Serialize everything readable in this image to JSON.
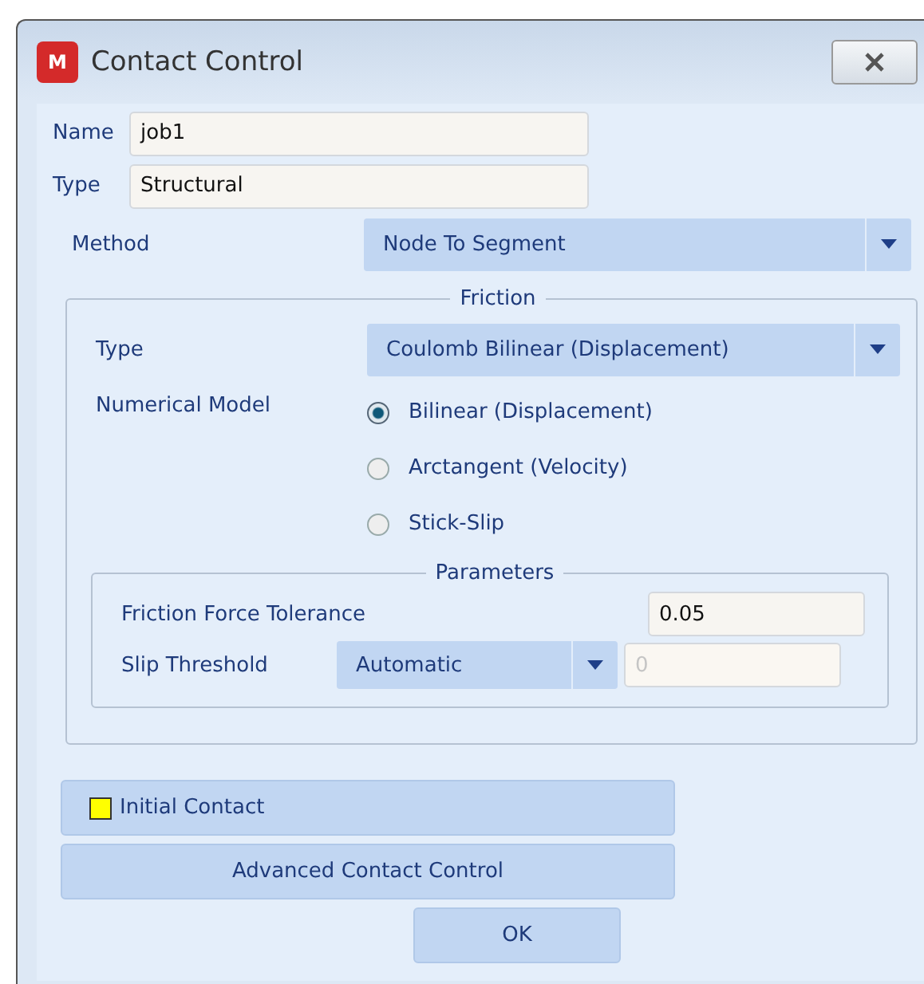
{
  "window": {
    "title": "Contact Control",
    "icon_letter": "M"
  },
  "fields": [
    {
      "label": "Name",
      "value": "job1"
    },
    {
      "label": "Type",
      "value": "Structural"
    }
  ],
  "method": {
    "label": "Method",
    "value": "Node To Segment"
  },
  "friction": {
    "title": "Friction",
    "type": {
      "label": "Type",
      "value": "Coulomb Bilinear (Displacement)"
    },
    "numerical_model": {
      "label": "Numerical Model",
      "options": [
        {
          "label": "Bilinear (Displacement)",
          "selected": true
        },
        {
          "label": "Arctangent (Velocity)",
          "selected": false
        },
        {
          "label": "Stick-Slip",
          "selected": false
        }
      ]
    },
    "parameters": {
      "title": "Parameters",
      "tolerance": {
        "label": "Friction Force Tolerance",
        "value": "0.05"
      },
      "slip": {
        "label": "Slip Threshold",
        "mode": "Automatic",
        "value": "0",
        "disabled": true
      }
    }
  },
  "initial_contact": {
    "label": "Initial Contact",
    "on": true
  },
  "buttons": [
    "Advanced Contact Control",
    "OK"
  ]
}
